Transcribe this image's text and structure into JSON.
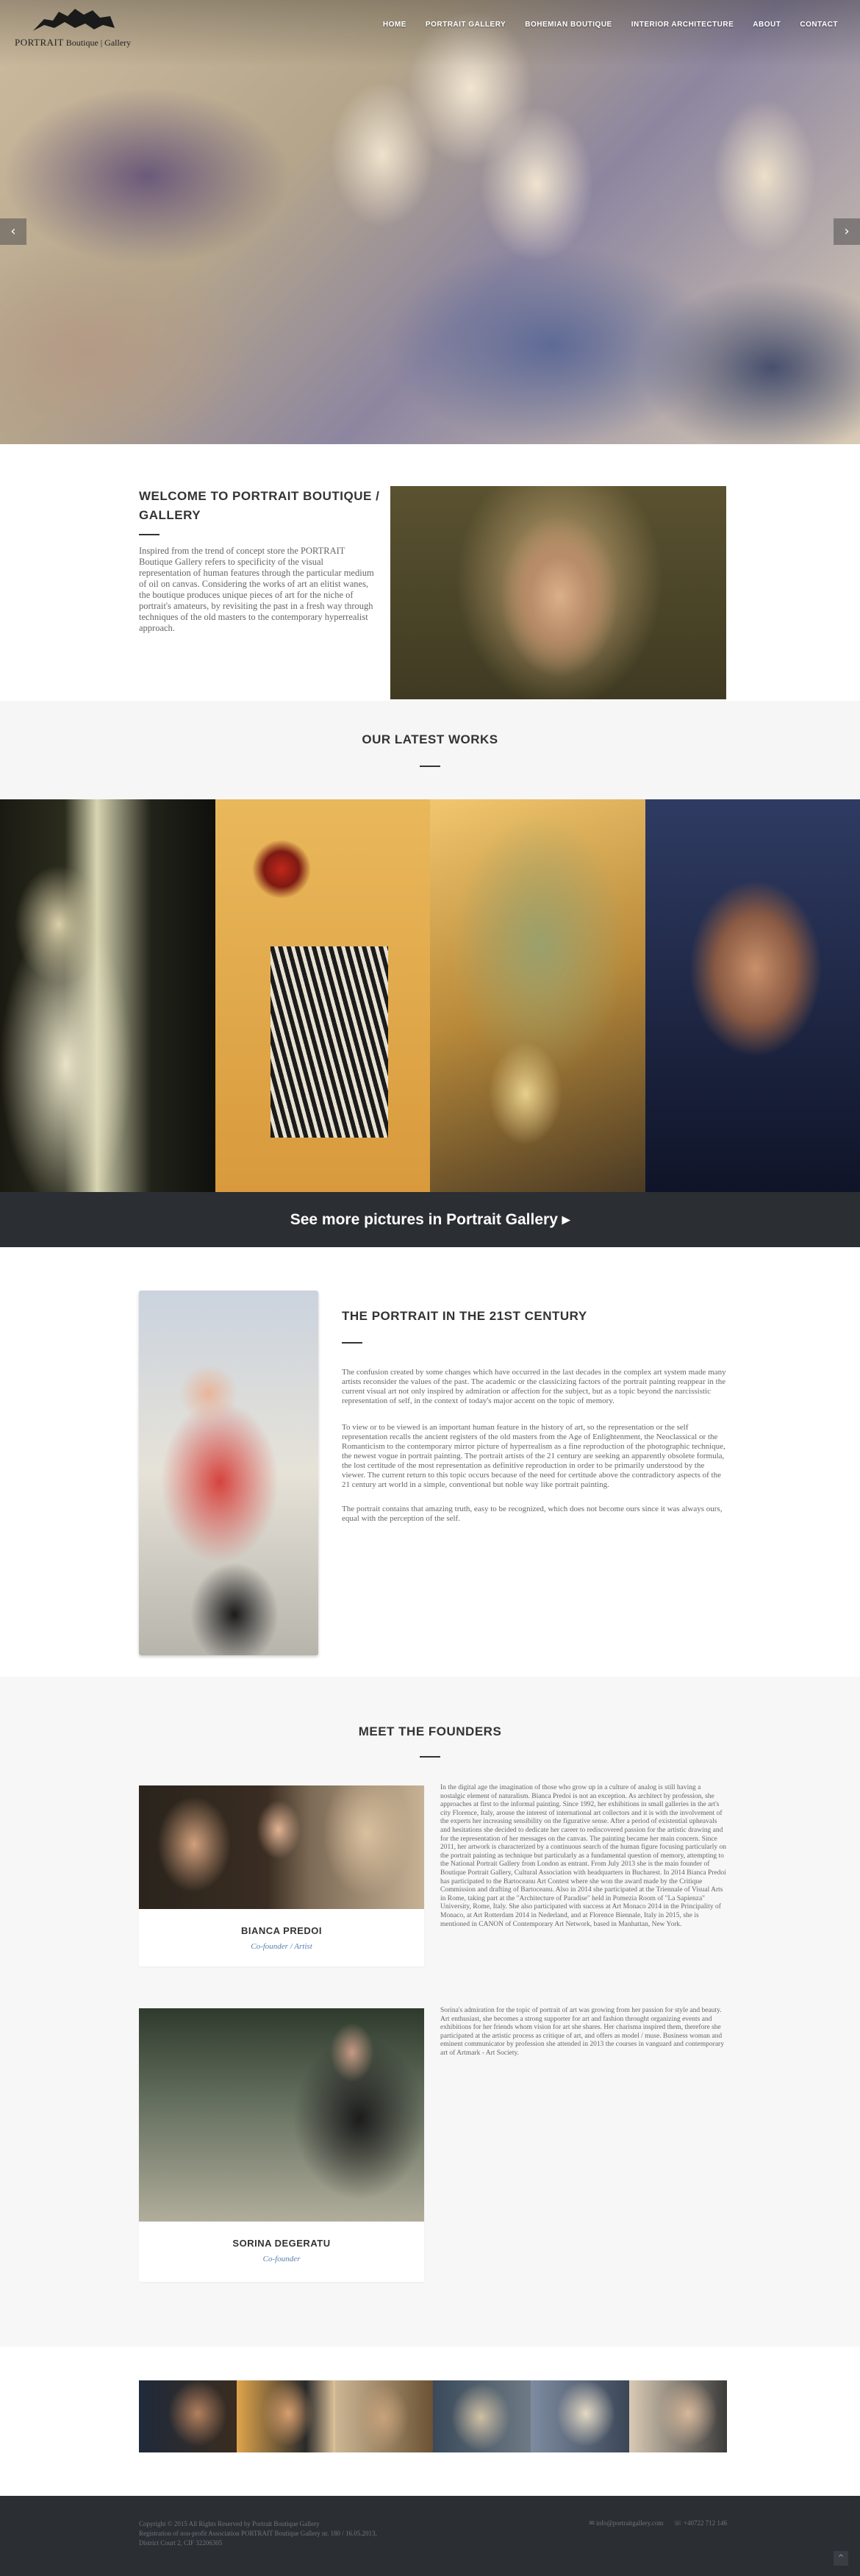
{
  "header": {
    "logo_title": "PORTRAIT",
    "logo_subtitle": "Boutique | Gallery",
    "nav": [
      "HOME",
      "PORTRAIT GALLERY",
      "BOHEMIAN BOUTIQUE",
      "INTERIOR ARCHITECTURE",
      "ABOUT",
      "CONTACT"
    ],
    "slider_prev": "‹",
    "slider_next": "›"
  },
  "welcome": {
    "title": "WELCOME TO PORTRAIT BOUTIQUE / GALLERY",
    "text": "Inspired from the trend of concept store the PORTRAIT Boutique Gallery refers to specificity of the visual representation of human features through the particular medium of oil on canvas. Considering the works of art an elitist wanes, the boutique produces unique pieces of art for the niche of portrait's amateurs, by revisiting the past in a fresh way through techniques of the old masters to the contemporary hyperrealist approach."
  },
  "latest_works": {
    "title": "OUR LATEST WORKS",
    "more_label": "See more pictures in Portrait Gallery",
    "more_arrow": "▸"
  },
  "century": {
    "title": "THE PORTRAIT IN THE 21ST CENTURY",
    "p1": "The confusion created by some changes which have occurred in the last decades in the complex art system made many artists reconsider the values of the past. The academic or the classicizing factors of the portrait painting reappear in the current visual art not only inspired by admiration or affection for the subject, but as a topic beyond the narcissistic representation of self, in the context of today's major accent on the topic of memory.",
    "p2": "To view or to be viewed is an important human feature in the history of art, so the representation or the self representation recalls the ancient registers of the old masters from the Age of Enlightenment, the Neoclassical or the Romanticism to the contemporary mirror picture of hyperrealism as a fine reproduction of the photographic technique, the newest vogue in portrait painting. The portrait artists of the 21 century are seeking an apparently obsolete formula, the lost certitude of the most representation as definitive reproduction in order to be primarily understood by the viewer. The current return to this topic occurs because of the need for certitude above the contradictory aspects of the 21 century art world in a simple, conventional but noble way like portrait painting.",
    "p3": "The portrait contains that amazing truth, easy to be recognized, which does not become ours since it was always ours, equal with the perception of the self."
  },
  "founders": {
    "title": "MEET THE FOUNDERS",
    "people": [
      {
        "name": "BIANCA PREDOI",
        "role": "Co-founder / Artist",
        "bio": "In the digital age the imagination of those who grow up in a culture of analog is still having a nostalgic element of naturalism. Bianca Predoi is not an exception. As architect by profession, she approaches at first to the informal painting. Since 1992, her exhibitions in small galleries in the art's city Florence, Italy, arouse the interest of international art collectors and it is with the involvement of the experts her increasing sensibility on the figurative sense. After a period of existential upheavals and hesitations she decided to dedicate her career to rediscovered passion for the artistic drawing and for the representation of her messages on the canvas. The painting became her main concern. Since 2011, her artwork is characterized by a continuous search of the human figure focusing particularly on the portrait painting as technique but particularly as a fundamental question of memory, attempting to the National Portrait Gallery from London as entrant. From July 2013 she is the main founder of Boutique Portrait Gallery, Cultural Association with headquarters in Bucharest. In 2014 Bianca Predoi has participated to the Bartoceanu Art Contest where she won the award made by the Critique Commission and drafting of Bartoceanu. Also in 2014 she participated at the Triennale of Visual Arts in Rome, taking part at the \"Architecture of Paradise\" held in Pomezia Room of \"La Sapienza\" University, Rome, Italy. She also participated with success at Art Monaco 2014 in the Principality of Monaco, at Art Rotterdam 2014 in Nederland, and at Florence Biennale, Italy in 2015, she is mentioned in CANON of Contemporary Art Network, based in Manhattan, New York."
      },
      {
        "name": "SORINA DEGERATU",
        "role": "Co-founder",
        "bio": "Sorina's admiration for the topic of portrait of art was growing from her passion for style and beauty. Art enthusiast, she becomes a strong supporter for art and fashion throught organizing events and exhibitions for her friends whom vision for art she shares. Her charisma inspired them, therefore she participated at the artistic process as critique of art, and offers as model / muse. Business woman and eminent communicator by profession she attended in 2013 the courses in vanguard and contemporary art of Artmark - Art Society."
      }
    ]
  },
  "footer": {
    "copyright": "Copyright © 2015 All Rights Reserved by Portrait Boutique Gallery",
    "registration": "Registration of non-profit Association PORTRAIT Boutique Gallery nr. 180 / 16.05.2013,",
    "address": "District Court 2, CIF 32206305",
    "email": "✉ info@portraitgallery.com",
    "phone": "☏ +40722 712 146",
    "to_top": "^"
  },
  "colors": {
    "dark_band": "#2b2e33",
    "light_band": "#f7f7f7",
    "accent_blue": "#5a7fae"
  }
}
